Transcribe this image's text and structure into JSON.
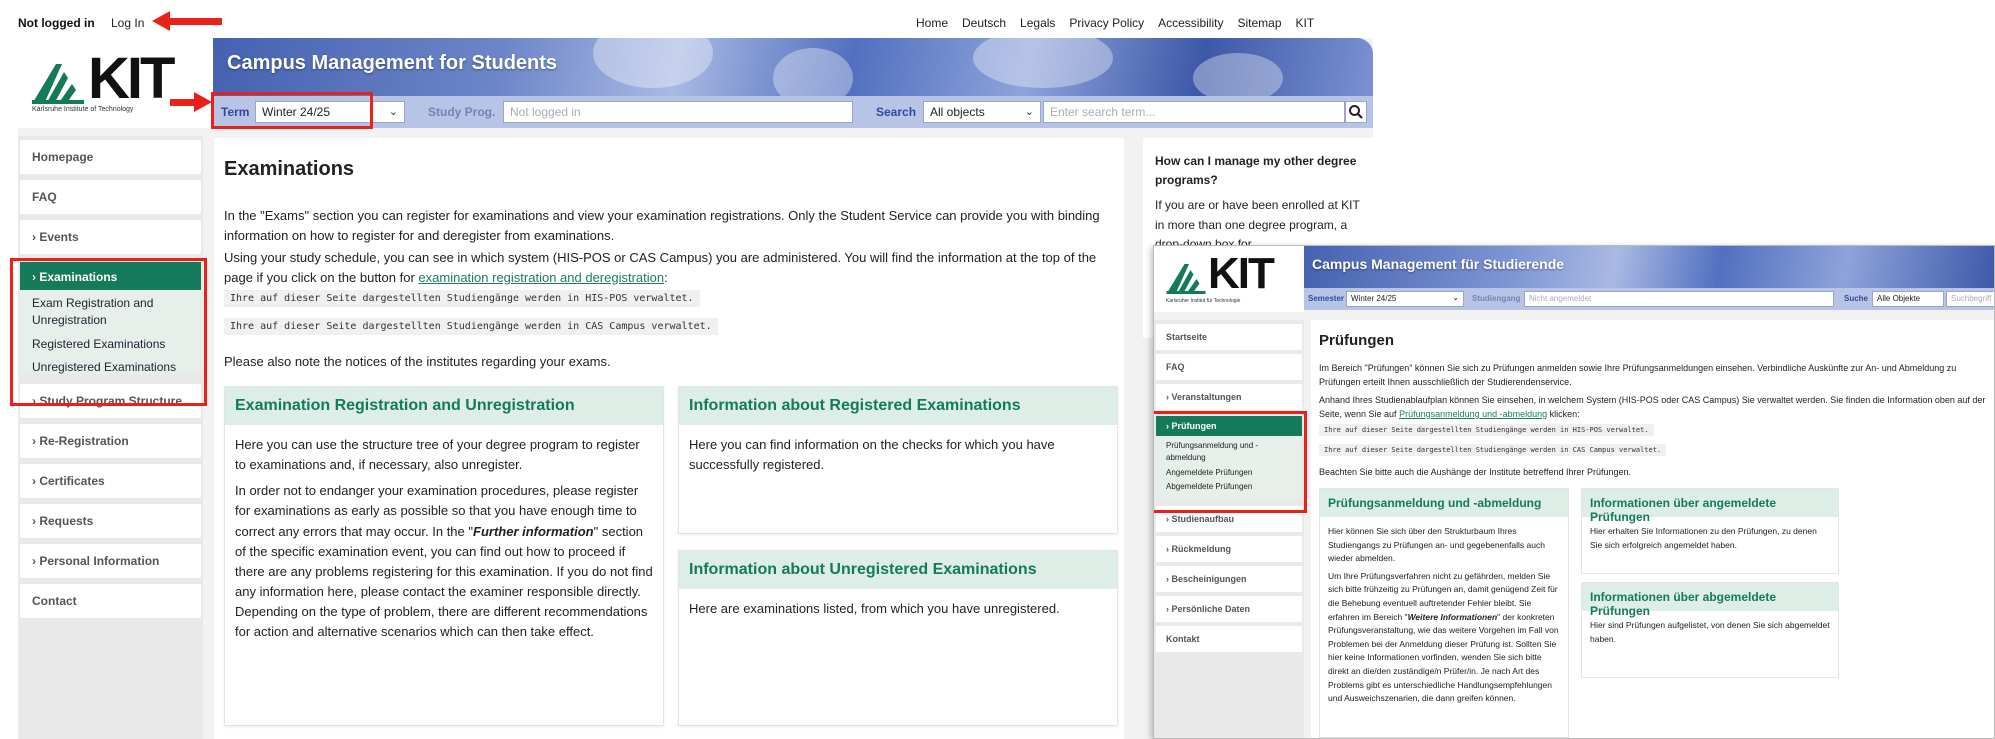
{
  "topbar": {
    "login_status": "Not logged in",
    "login_link": "Log In",
    "links": [
      "Home",
      "Deutsch",
      "Legals",
      "Privacy Policy",
      "Accessibility",
      "Sitemap",
      "KIT"
    ]
  },
  "main": {
    "logo_text": "KIT",
    "logo_caption": "Karlsruhe Institute of Technology",
    "app_title": "Campus Management for Students",
    "search_bar": {
      "term_label": "Term",
      "term_value": "Winter 24/25",
      "study_prog_label": "Study Prog.",
      "study_prog_value": "Not logged in",
      "search_label": "Search",
      "scope_value": "All objects",
      "search_placeholder": "Enter search term..."
    },
    "sidebar": {
      "items_top": [
        "Homepage",
        "FAQ",
        "› Events"
      ],
      "active": "› Examinations",
      "sub_items": [
        "Exam Registration and Unregistration",
        "Registered Examinations",
        "Unregistered Examinations"
      ],
      "items_bottom": [
        "› Study Program Structure",
        "› Re-Registration",
        "› Certificates",
        "› Requests",
        "› Personal Information",
        "Contact"
      ]
    },
    "content": {
      "title": "Examinations",
      "intro": "In the \"Exams\" section you can register for examinations and view your examination registrations. Only the Student Service can provide you with binding information on how to register for and deregister from examinations.",
      "schedule_text": "Using your study schedule, you can see in which system (HIS-POS or CAS Campus) you are administered. You will find the information at the top of the page if you click on the button for ",
      "schedule_link": "examination registration and deregistration",
      "schedule_end": ":",
      "code1": "Ihre auf dieser Seite dargestellten Studiengänge werden in HIS-POS verwaltet.",
      "code2": "Ihre auf dieser Seite dargestellten Studiengänge werden in CAS Campus verwaltet.",
      "notice": "Please also note the notices of the institutes regarding your exams.",
      "card1_title": "Examination Registration and Unregistration",
      "card1_p1": "Here you can use the structure tree of your degree program to register to examinations and, if necessary, also unregister.",
      "card1_p2a": "In order not to endanger your examination procedures, please register for examinations as early as possible so that you have enough time to correct any errors that may occur. In the \"",
      "card1_p2_bold": "Further information",
      "card1_p2b": "\" section of the specific examination event, you can find out how to proceed if there are any problems registering for this examination. If you do not find any information here, please contact the examiner responsible directly. Depending on the type of problem, there are different recommendations for action and alternative scenarios which can then take effect.",
      "card2_title": "Information about Registered Examinations",
      "card2_body": "Here you can find information on the checks for which you have successfully registered.",
      "card3_title": "Information about Unregistered Examinations",
      "card3_body": "Here are examinations listed, from which you have unregistered."
    },
    "right_box": {
      "title": "How can I manage my other degree programs?",
      "body": "If you are or have been enrolled at KIT in more than one degree program, a drop-down box for"
    }
  },
  "german": {
    "logo_text": "KIT",
    "logo_caption": "Karlsruher Institut für Technologie",
    "app_title": "Campus Management für Studierende",
    "search_bar": {
      "term_label": "Semester",
      "term_value": "Winter 24/25",
      "study_prog_label": "Studiengang",
      "study_prog_value": "Nicht angemeldet",
      "search_label": "Suche",
      "scope_value": "Alle Objekte",
      "search_placeholder": "Suchbegriff eingeben"
    },
    "sidebar": {
      "items_top": [
        "Startseite",
        "FAQ",
        "› Veranstaltungen"
      ],
      "active": "› Prüfungen",
      "sub_items": [
        "Prüfungsanmeldung und -abmeldung",
        "Angemeldete Prüfungen",
        "Abgemeldete Prüfungen"
      ],
      "items_bottom": [
        "› Studienaufbau",
        "› Rückmeldung",
        "› Bescheinigungen",
        "› Persönliche Daten",
        "Kontakt"
      ]
    },
    "content": {
      "title": "Prüfungen",
      "intro": "Im Bereich \"Prüfungen\" können Sie sich zu Prüfungen anmelden sowie Ihre Prüfungsanmeldungen einsehen. Verbindliche Auskünfte zur An- und Abmeldung zu Prüfungen erteilt Ihnen ausschließlich der Studierendenservice.",
      "schedule_text": "Anhand Ihres Studienablaufplan können Sie einsehen, in welchem System (HIS-POS oder CAS Campus) Sie verwaltet werden. Sie finden die Information oben auf der Seite, wenn Sie auf ",
      "schedule_link": "Prüfungsanmeldung und -abmeldung",
      "schedule_end": " klicken:",
      "code1": "Ihre auf dieser Seite dargestellten Studiengänge werden in HIS-POS verwaltet.",
      "code2": "Ihre auf dieser Seite dargestellten Studiengänge werden in CAS Campus verwaltet.",
      "notice": "Beachten Sie bitte auch die Aushänge der Institute betreffend Ihrer Prüfungen.",
      "card1_title": "Prüfungsanmeldung und -abmeldung",
      "card1_p1": "Hier können Sie sich über den Strukturbaum Ihres Studiengangs zu Prüfungen an- und gegebenenfalls auch wieder abmelden.",
      "card1_p2a": "Um Ihre Prüfungsverfahren nicht zu gefährden, melden Sie sich bitte frühzeitig zu Prüfungen an, damit genügend Zeit für die Behebung eventuell auftretender Fehler bleibt. Sie erfahren im Bereich \"",
      "card1_p2_bold": "Weitere Informationen",
      "card1_p2b": "\" der konkreten Prüfungsveranstaltung, wie das weitere Vorgehen im Fall von Problemen bei der Anmeldung dieser Prüfung ist. Sollten Sie hier keine Informationen vorfinden, wenden Sie sich bitte direkt an die/den zuständige/n Prüfer/in. Je nach Art des Problems gibt es unterschiedliche Handlungsempfehlungen und Ausweichszenarien, die dann greifen können.",
      "card2_title": "Informationen über angemeldete Prüfungen",
      "card2_body": "Hier erhalten Sie Informationen zu den Prüfungen, zu denen Sie sich erfolgreich angemeldet haben.",
      "card3_title": "Informationen über abgemeldete Prüfungen",
      "card3_body": "Hier sind Prüfungen aufgelistet, von denen Sie sich abgemeldet haben."
    }
  },
  "colors": {
    "accent_green": "#157a5a",
    "card_head_bg": "#dceee6",
    "annotation_red": "#e8221b",
    "banner_blue": "#4561b0"
  }
}
